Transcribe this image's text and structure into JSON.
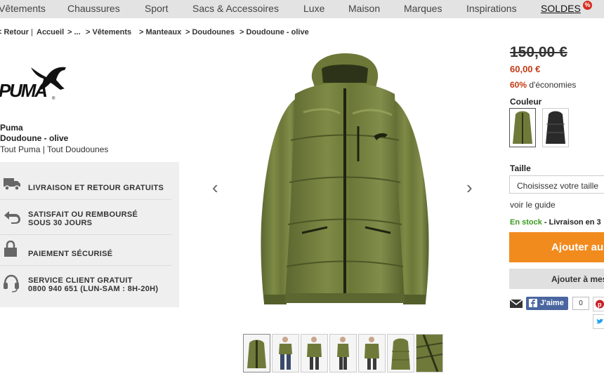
{
  "topnav": {
    "items": [
      "Vêtements",
      "Chaussures",
      "Sport",
      "Sacs & Accessoires",
      "Luxe",
      "Maison",
      "Marques",
      "Inspirations",
      "SOLDES"
    ],
    "badge": "%"
  },
  "breadcrumb": {
    "items": [
      "< Retour",
      "|",
      "Accueil",
      "> ...",
      "> Vêtements",
      "> Manteaux",
      "> Doudounes",
      "> Doudoune - olive"
    ]
  },
  "brand": {
    "logo_text": "PUMA",
    "name": "Puma",
    "product": "Doudoune - olive",
    "link_all_brand": "Tout Puma",
    "separator": "|",
    "link_all_category": "Tout Doudounes"
  },
  "services": [
    {
      "icon": "truck-icon",
      "line1": "LIVRAISON ET RETOUR GRATUITS",
      "line2": ""
    },
    {
      "icon": "return-arrow-icon",
      "line1": "SATISFAIT OU REMBOURSÉ",
      "line2": "SOUS 30 JOURS"
    },
    {
      "icon": "lock-icon",
      "line1": "PAIEMENT SÉCURISÉ",
      "line2": ""
    },
    {
      "icon": "headset-icon",
      "line1": "SERVICE CLIENT GRATUIT",
      "line2": "0800 940 651 (LUN-SAM : 8H-20H)"
    }
  ],
  "gallery": {
    "prev": "‹",
    "next": "›",
    "thumb_count": 7
  },
  "price": {
    "old": "150,00 €",
    "new": "60,00 €",
    "percent": "60%",
    "savings_text": "d'économies"
  },
  "color": {
    "label": "Couleur",
    "options": [
      "olive",
      "noir"
    ]
  },
  "size": {
    "label": "Taille",
    "placeholder": "Choisissez votre taille",
    "guide": "voir le guide"
  },
  "stock": {
    "status": "En stock",
    "delivery": " - Livraison en 3"
  },
  "actions": {
    "add_cart": "Ajouter au",
    "add_wishlist": "Ajouter à mes"
  },
  "social": {
    "fb_label": "J'aime",
    "fb_count": "0"
  },
  "colors": {
    "accent": "#f28b1e",
    "price_red": "#c33a14",
    "stock_green": "#3a9a1e",
    "facebook": "#4a66a0",
    "jacket": "#6f7a3a"
  }
}
